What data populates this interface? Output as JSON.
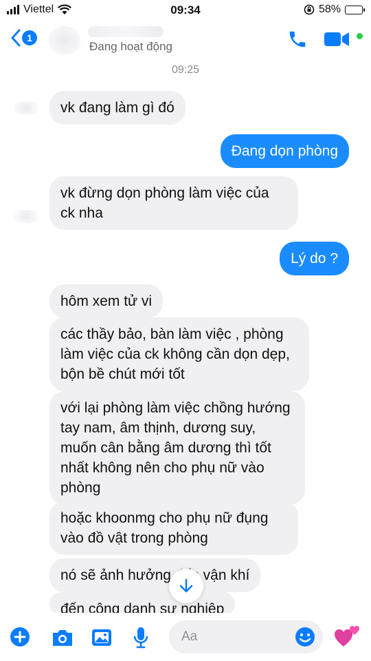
{
  "status_bar": {
    "carrier": "Viettel",
    "time": "09:34",
    "battery": "58%",
    "battery_level": 0.58
  },
  "header": {
    "back_count": "1",
    "status": "Đang hoạt động",
    "icons": {
      "back": "chevron-left-icon",
      "call": "phone-icon",
      "video": "video-camera-icon"
    }
  },
  "conversation": {
    "timestamp": "09:25",
    "messages": [
      {
        "from": "them",
        "text": "vk đang làm gì đó"
      },
      {
        "from": "me",
        "text": "Đang dọn phòng"
      },
      {
        "from": "them",
        "text": "vk đừng dọn phòng làm việc của ck nha"
      },
      {
        "from": "me",
        "text": "Lý do ?"
      },
      {
        "from": "them",
        "text": "hôm xem tử vi"
      },
      {
        "from": "them",
        "text": "các thầy bảo, bàn làm việc , phòng làm việc của ck không cần dọn dẹp, bộn bề chút mới tốt"
      },
      {
        "from": "them",
        "text": "với lại phòng làm việc chồng hướng tay nam, âm thịnh, dương suy, muốn cân bằng âm dương thì tốt nhất không nên cho phụ nữ vào phòng"
      },
      {
        "from": "them",
        "text": "hoặc khoonmg cho phụ nữ đụng vào đồ vật trong phòng"
      },
      {
        "from": "them",
        "text": "nó sẽ ảnh hưởng đến vận khí"
      },
      {
        "from": "them",
        "text": "đến công danh sự nghiệp"
      }
    ]
  },
  "composer": {
    "placeholder": "Aa",
    "icons": [
      "plus-icon",
      "camera-icon",
      "gallery-icon",
      "microphone-icon",
      "emoji-icon",
      "hearts-icon"
    ]
  },
  "colors": {
    "accent": "#0a7cff",
    "outgoing_bubble": "#1a8cff",
    "incoming_bubble": "#f0f0f2",
    "online": "#2ecc40",
    "hearts": "#e040a0"
  }
}
